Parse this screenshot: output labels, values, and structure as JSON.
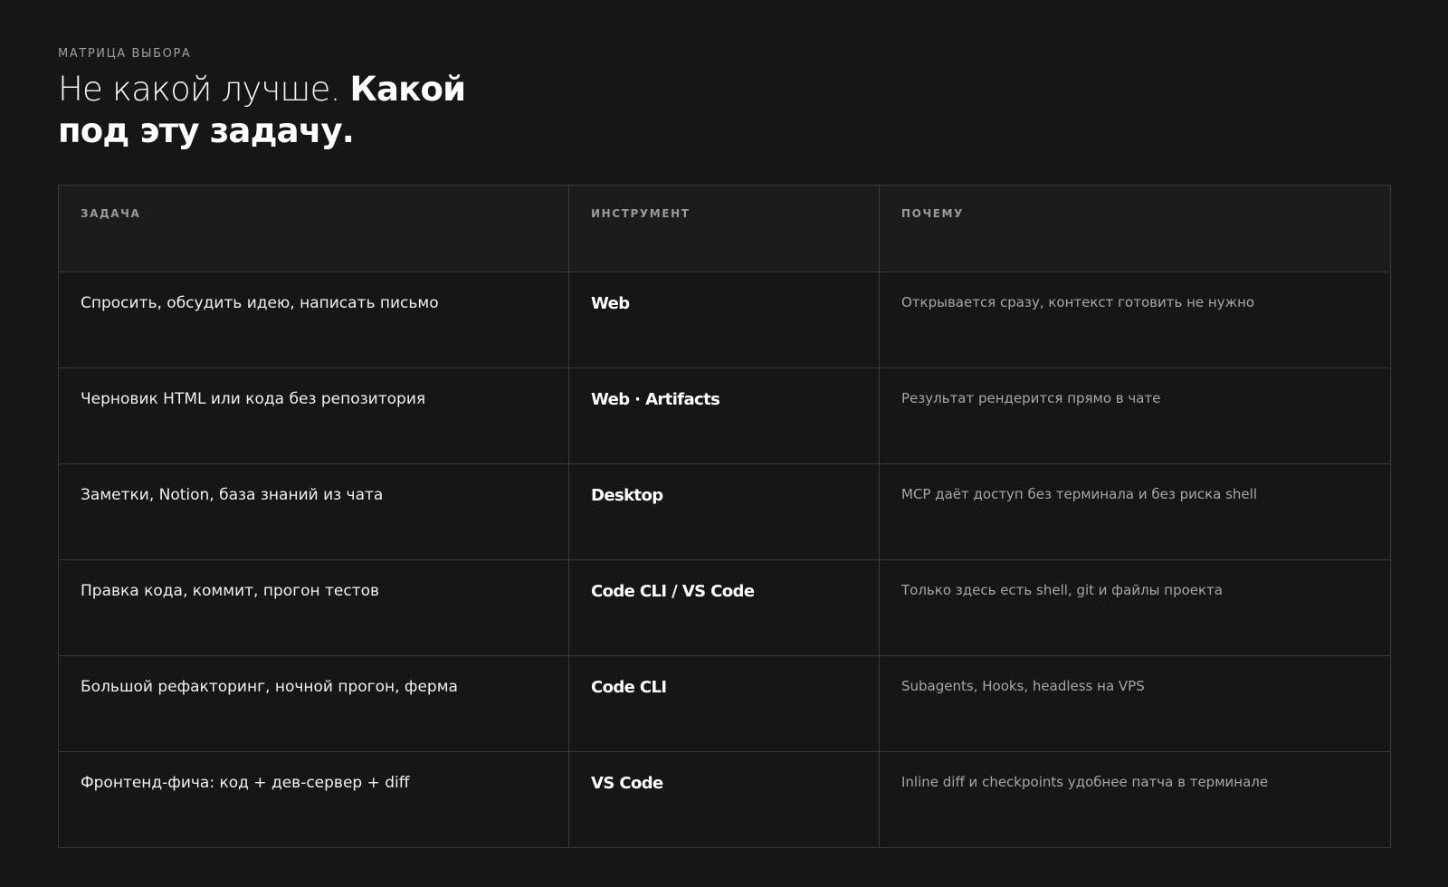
{
  "section": {
    "eyebrow": "МАТРИЦА ВЫБОРА",
    "title_light": "Не какой лучше.",
    "title_bold": "Какой под эту задачу."
  },
  "table": {
    "headers": [
      "ЗАДАЧА",
      "ИНСТРУМЕНТ",
      "ПОЧЕМУ"
    ],
    "rows": [
      {
        "task": "Спросить, обсудить идею, написать письмо",
        "tool": "Web",
        "reason": "Открывается сразу, контекст готовить не нужно"
      },
      {
        "task": "Черновик HTML или кода без репозитория",
        "tool": "Web · Artifacts",
        "reason": "Результат рендерится прямо в чате"
      },
      {
        "task": "Заметки, Notion, база знаний из чата",
        "tool": "Desktop",
        "reason": "MCP даёт доступ без терминала и без риска shell"
      },
      {
        "task": "Правка кода, коммит, прогон тестов",
        "tool": "Code CLI / VS Code",
        "reason": "Только здесь есть shell, git и файлы проекта"
      },
      {
        "task": "Большой рефакторинг, ночной прогон, ферма",
        "tool": "Code CLI",
        "reason": "Subagents, Hooks, headless на VPS"
      },
      {
        "task": "Фронтенд-фича: код + дев-сервер + diff",
        "tool": "VS Code",
        "reason": "Inline diff и checkpoints удобнее патча в терминале"
      }
    ]
  },
  "colors": {
    "background": "#161616",
    "header_background": "#1c1c1b",
    "border": "#3a3a38",
    "text_primary": "#f0f0ee",
    "text_muted": "#a8a7a2"
  }
}
